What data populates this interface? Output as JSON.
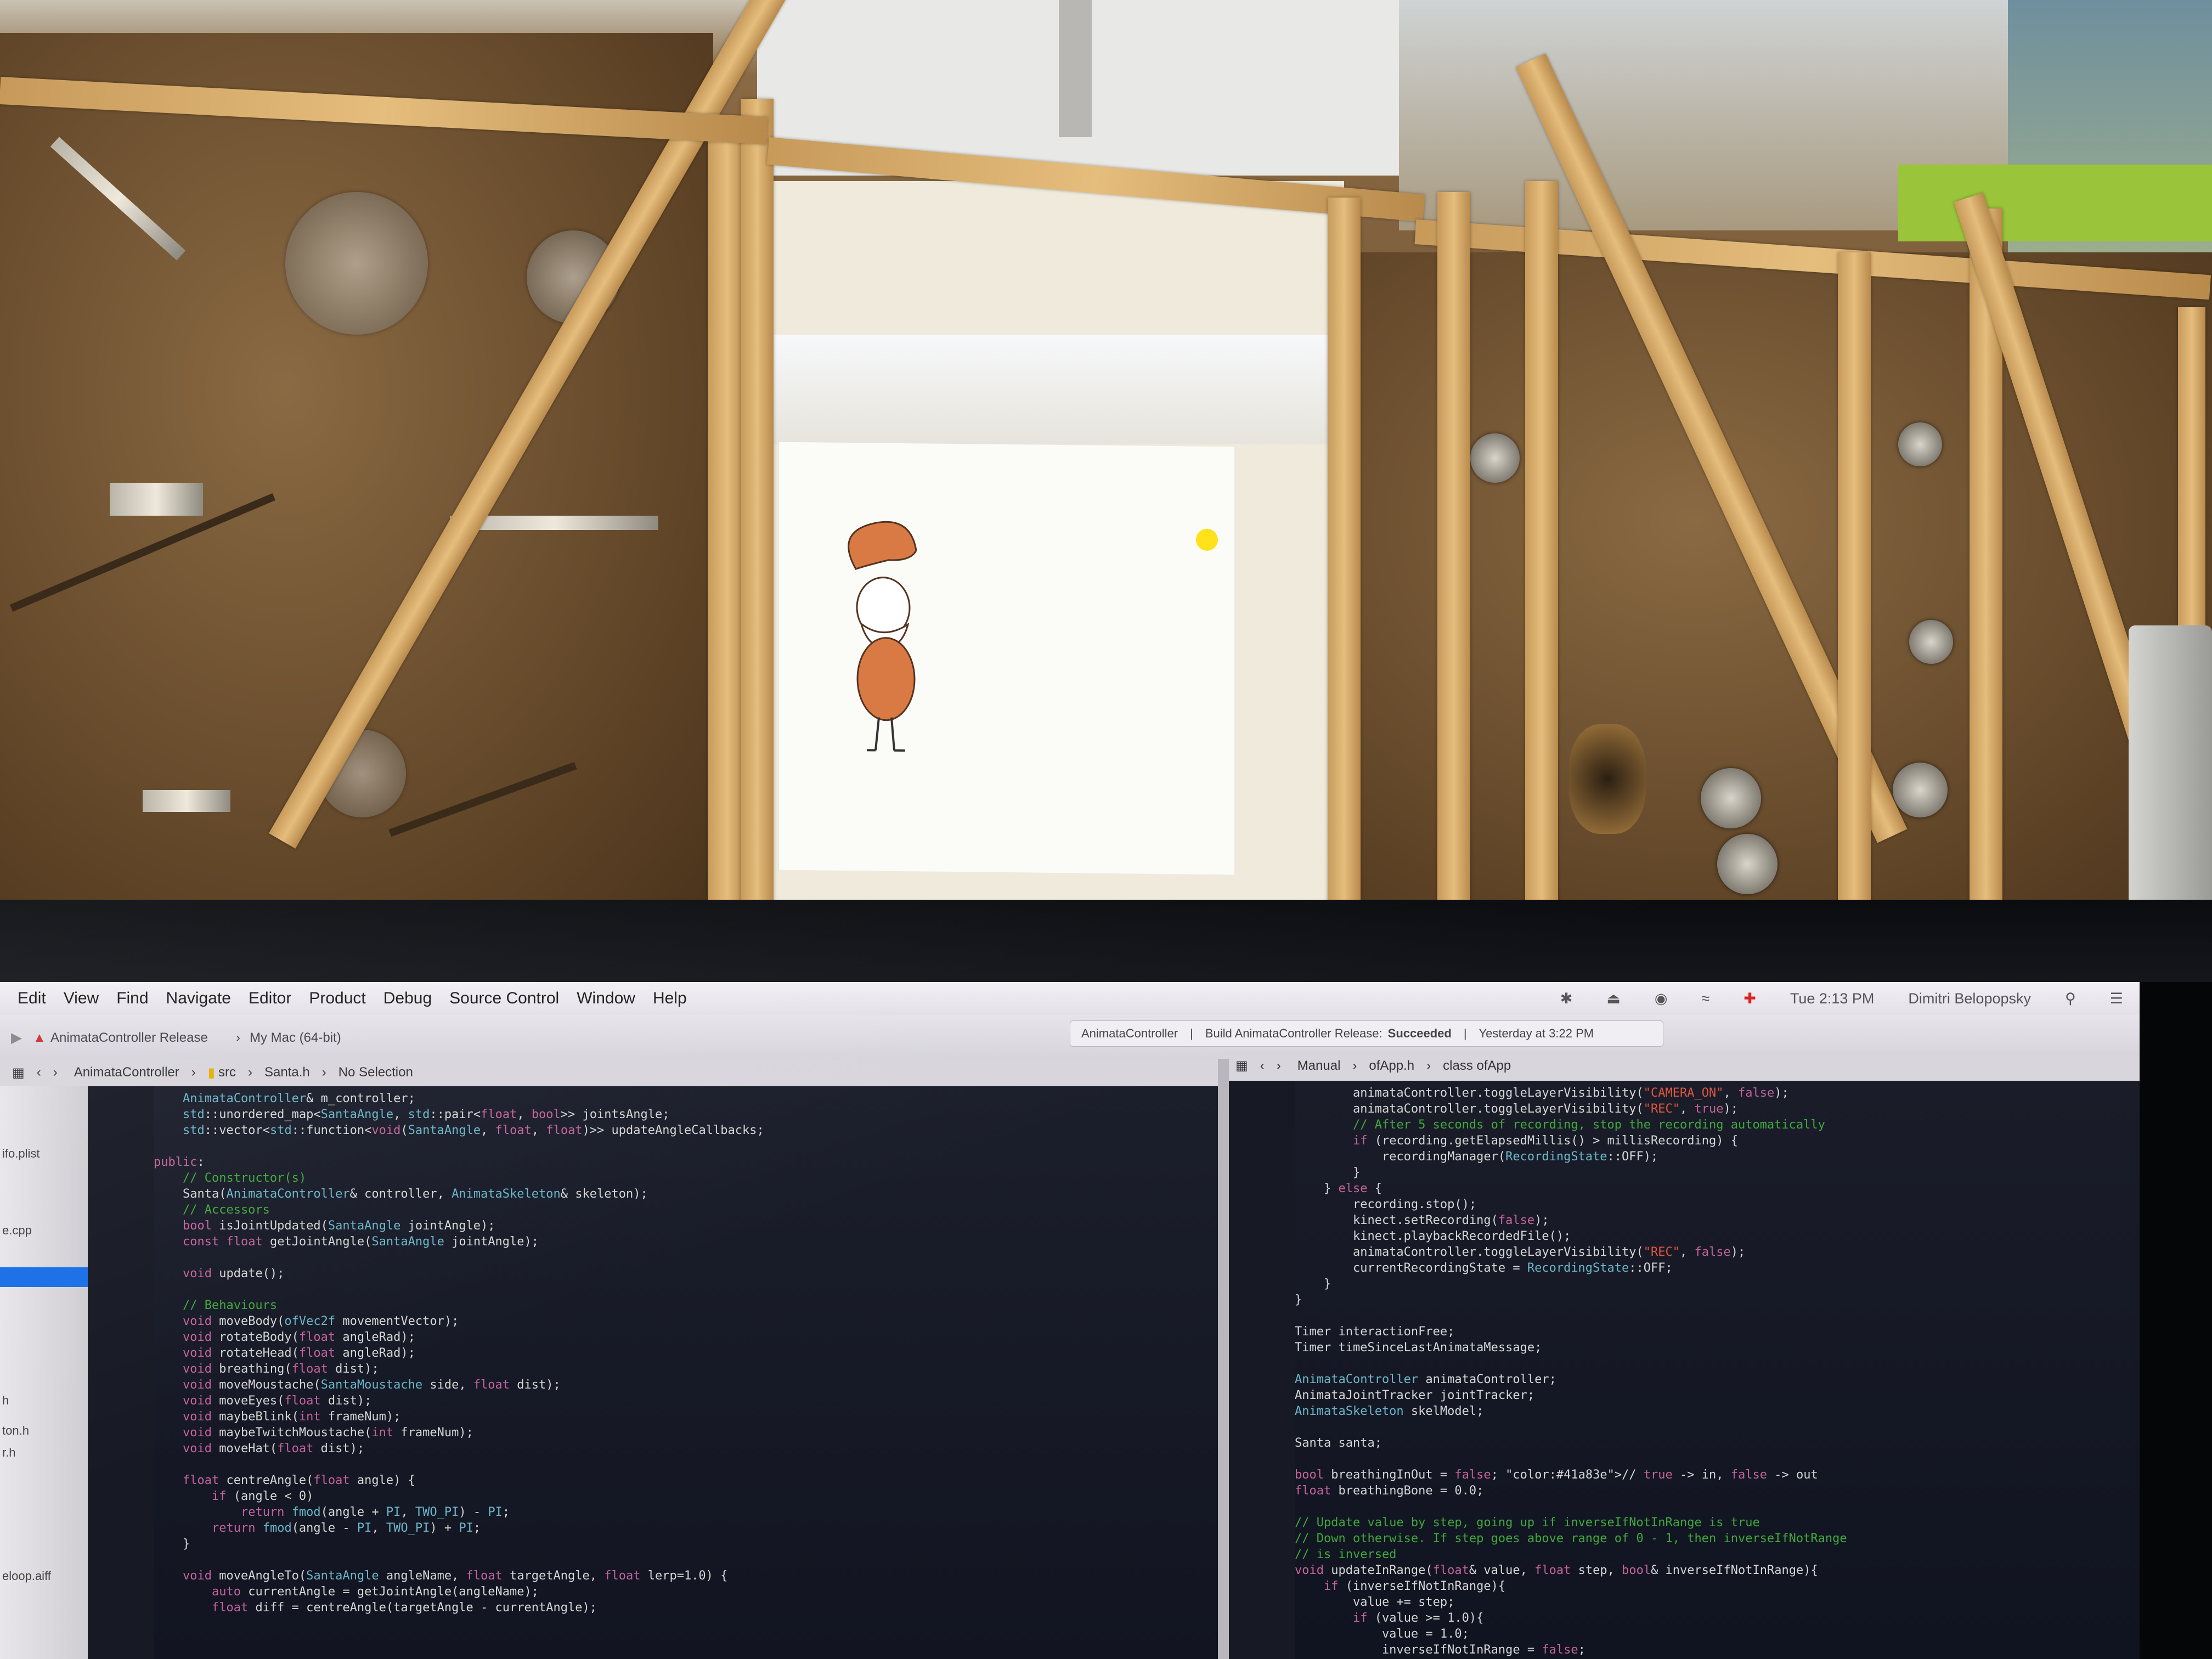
{
  "menubar": {
    "items": [
      "Edit",
      "View",
      "Find",
      "Navigate",
      "Editor",
      "Product",
      "Debug",
      "Source Control",
      "Window",
      "Help"
    ],
    "clock": "Tue 2:13 PM",
    "user": "Dimitri Belopopsky"
  },
  "toolbar": {
    "scheme": "AnimataController Release",
    "destination": "My Mac (64-bit)",
    "activity_target": "AnimataController",
    "activity_status_prefix": "Build AnimataController Release:",
    "activity_status_result": "Succeeded",
    "activity_time": "Yesterday at 3:22 PM"
  },
  "jumpbar_left": {
    "project": "AnimataController",
    "folder": "src",
    "file": "Santa.h",
    "selection": "No Selection"
  },
  "jumpbar_right": {
    "mode": "Manual",
    "file": "ofApp.h",
    "symbol": "class ofApp"
  },
  "navigator": {
    "items": [
      "ifo.plist",
      "e.cpp",
      "h",
      "ton.h",
      "r.h",
      "eloop.aiff"
    ]
  },
  "editor_left": {
    "lines": [
      "    AnimataController& m_controller;",
      "    std::unordered_map<SantaAngle, std::pair<float, bool>> jointsAngle;",
      "    std::vector<std::function<void(SantaAngle, float, float)>> updateAngleCallbacks;",
      "",
      "public:",
      "    // Constructor(s)",
      "    Santa(AnimataController& controller, AnimataSkeleton& skeleton);",
      "    // Accessors",
      "    bool isJointUpdated(SantaAngle jointAngle);",
      "    const float getJointAngle(SantaAngle jointAngle);",
      "",
      "    void update();",
      "",
      "    // Behaviours",
      "    void moveBody(ofVec2f movementVector);",
      "    void rotateBody(float angleRad);",
      "    void rotateHead(float angleRad);",
      "    void breathing(float dist);",
      "    void moveMoustache(SantaMoustache side, float dist);",
      "    void moveEyes(float dist);",
      "    void maybeBlink(int frameNum);",
      "    void maybeTwitchMoustache(int frameNum);",
      "    void moveHat(float dist);",
      "",
      "    float centreAngle(float angle) {",
      "        if (angle < 0)",
      "            return fmod(angle + PI, TWO_PI) - PI;",
      "        return fmod(angle - PI, TWO_PI) + PI;",
      "    }",
      "",
      "    void moveAngleTo(SantaAngle angleName, float targetAngle, float lerp=1.0) {",
      "        auto currentAngle = getJointAngle(angleName);",
      "        float diff = centreAngle(targetAngle - currentAngle);"
    ]
  },
  "editor_right": {
    "lines": [
      "        animataController.toggleLayerVisibility(\"CAMERA_ON\", false);",
      "        animataController.toggleLayerVisibility(\"REC\", true);",
      "        // After 5 seconds of recording, stop the recording automatically",
      "        if (recording.getElapsedMillis() > millisRecording) {",
      "            recordingManager(RecordingState::OFF);",
      "        }",
      "    } else {",
      "        recording.stop();",
      "        kinect.setRecording(false);",
      "        kinect.playbackRecordedFile();",
      "        animataController.toggleLayerVisibility(\"REC\", false);",
      "        currentRecordingState = RecordingState::OFF;",
      "    }",
      "}",
      "",
      "Timer interactionFree;",
      "Timer timeSinceLastAnimataMessage;",
      "",
      "AnimataController animataController;",
      "AnimataJointTracker jointTracker;",
      "AnimataSkeleton skelModel;",
      "",
      "Santa santa;",
      "",
      "bool breathingInOut = false; // true -> in, false -> out",
      "float breathingBone = 0.0;",
      "",
      "// Update value by step, going up if inverseIfNotInRange is true",
      "// Down otherwise. If step goes above range of 0 - 1, then inverseIfNotRange",
      "// is inversed",
      "void updateInRange(float& value, float step, bool& inverseIfNotInRange){",
      "    if (inverseIfNotInRange){",
      "        value += step;",
      "        if (value >= 1.0){",
      "            value = 1.0;",
      "            inverseIfNotInRange = false;"
    ]
  },
  "colors": {
    "editor_bg": "#151826",
    "keyword": "#c4649a",
    "comment": "#41a83e",
    "string": "#e0563f",
    "type": "#6bb6c9",
    "plain": "#d6d6d6",
    "menubar_bg": "#ece9ee",
    "selection": "#1a6ee8"
  }
}
